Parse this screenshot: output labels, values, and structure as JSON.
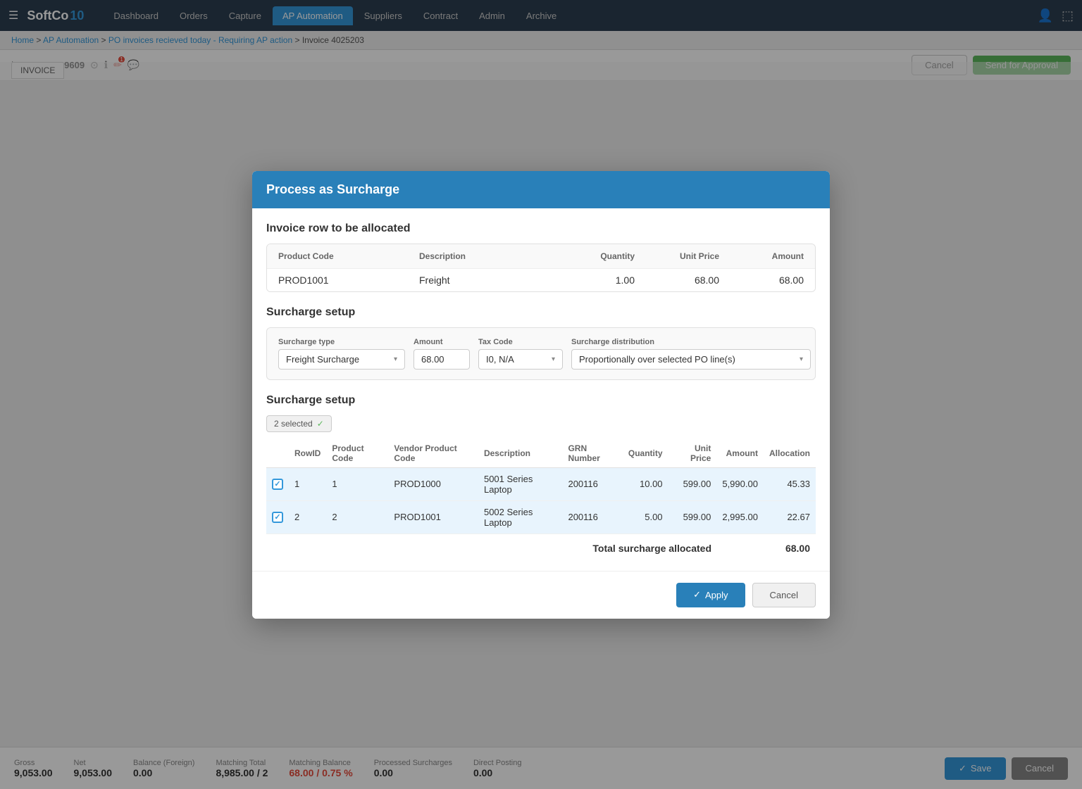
{
  "nav": {
    "logo": "SoftCo",
    "logo_suffix": "10",
    "items": [
      "Dashboard",
      "Orders",
      "Capture",
      "AP Automation",
      "Suppliers",
      "Contract",
      "Admin",
      "Archive"
    ],
    "active_item": "AP Automation"
  },
  "breadcrumb": {
    "parts": [
      "Home",
      "AP Automation",
      "PO invoices recieved today - Requiring AP action",
      "Invoice 4025203"
    ]
  },
  "case_bar": {
    "case_id": "CaseID 69609",
    "cancel_label": "Cancel",
    "send_label": "Send for Approval"
  },
  "bottom_bar": {
    "stats": [
      {
        "label": "Gross",
        "value": "9,053.00",
        "red": false
      },
      {
        "label": "Net",
        "value": "9,053.00",
        "red": false
      },
      {
        "label": "Balance (Foreign)",
        "value": "0.00",
        "red": false
      },
      {
        "label": "Matching Total",
        "value": "8,985.00 / 2",
        "red": false
      },
      {
        "label": "Matching Balance",
        "value": "68.00 / 0.75 %",
        "red": true
      },
      {
        "label": "Processed Surcharges",
        "value": "0.00",
        "red": false
      },
      {
        "label": "Direct Posting",
        "value": "0.00",
        "red": false
      }
    ],
    "save_label": "Save",
    "cancel_label": "Cancel"
  },
  "modal": {
    "title": "Process as Surcharge",
    "invoice_row_section": "Invoice row to be allocated",
    "invoice_row": {
      "headers": [
        "Product Code",
        "Description",
        "Quantity",
        "Unit Price",
        "Amount"
      ],
      "data": {
        "product_code": "PROD1001",
        "description": "Freight",
        "quantity": "1.00",
        "unit_price": "68.00",
        "amount": "68.00"
      }
    },
    "surcharge_setup1_title": "Surcharge setup",
    "surcharge_type_label": "Surcharge type",
    "surcharge_type_value": "Freight Surcharge",
    "amount_label": "Amount",
    "amount_value": "68.00",
    "tax_code_label": "Tax Code",
    "tax_code_value": "I0, N/A",
    "distribution_label": "Surcharge distribution",
    "distribution_value": "Proportionally over selected PO line(s)",
    "surcharge_setup2_title": "Surcharge setup",
    "selected_badge": "2 selected",
    "po_table": {
      "headers": [
        "RowID",
        "Product Code",
        "Vendor Product Code",
        "Description",
        "GRN Number",
        "Quantity",
        "Unit Price",
        "Amount",
        "Allocation"
      ],
      "rows": [
        {
          "checked": true,
          "row_id": "1",
          "product_code": "1",
          "vendor_product_code": "PROD1000",
          "description": "5001 Series Laptop",
          "grn_number": "200116",
          "quantity": "10.00",
          "unit_price": "599.00",
          "amount": "5,990.00",
          "allocation": "45.33"
        },
        {
          "checked": true,
          "row_id": "2",
          "product_code": "2",
          "vendor_product_code": "PROD1001",
          "description": "5002 Series Laptop",
          "grn_number": "200116",
          "quantity": "5.00",
          "unit_price": "599.00",
          "amount": "2,995.00",
          "allocation": "22.67"
        }
      ],
      "total_label": "Total surcharge allocated",
      "total_value": "68.00"
    },
    "apply_label": "Apply",
    "cancel_label": "Cancel"
  }
}
